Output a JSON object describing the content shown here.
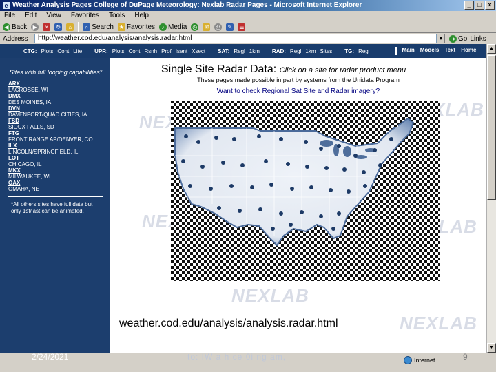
{
  "window": {
    "title": "Weather Analysis Pages College of DuPage Meteorology: Nexlab Radar Pages - Microsoft Internet Explorer",
    "icon": "ie-icon",
    "controls": [
      "_",
      "□",
      "×"
    ]
  },
  "menu": [
    "File",
    "Edit",
    "View",
    "Favorites",
    "Tools",
    "Help"
  ],
  "toolbar": {
    "back": "Back",
    "search": "Search",
    "favorites": "Favorites",
    "media": "Media"
  },
  "address": {
    "label": "Address",
    "value": "http://weather.cod.edu/analysis/analysis.radar.html",
    "go": "Go",
    "links": "Links"
  },
  "nav": {
    "groups": [
      {
        "label": "CTG:",
        "links": [
          "Plots",
          "Cont",
          "Lite"
        ]
      },
      {
        "label": "UPR:",
        "links": [
          "Plots",
          "Cont",
          "Rsnh",
          "Prof",
          "Isent",
          "Xsect"
        ]
      },
      {
        "label": "SAT:",
        "links": [
          "Regl",
          "1km"
        ]
      },
      {
        "label": "RAD:",
        "links": [
          "Regl",
          "1km",
          "Sites"
        ]
      },
      {
        "label": "TG:",
        "links": [
          "Regl"
        ]
      }
    ],
    "main": [
      "Main",
      "Models",
      "Text",
      "Home"
    ]
  },
  "sidebar": {
    "intro": "Sites with full looping capabilities*",
    "sites": [
      {
        "code": "ARX",
        "city": "LACROSSE, WI"
      },
      {
        "code": "DMX",
        "city": "DES MOINES, IA"
      },
      {
        "code": "DVN",
        "city": "DAVENPORT/QUAD CITIES, IA"
      },
      {
        "code": "FSD",
        "city": "SIOUX FALLS, SD"
      },
      {
        "code": "FTG",
        "city": "FRONT RANGE AP/DENVER, CO"
      },
      {
        "code": "ILX",
        "city": "LINCOLN/SPRINGFIELD, IL"
      },
      {
        "code": "LOT",
        "city": "CHICAGO, IL"
      },
      {
        "code": "MKX",
        "city": "MILWAUKEE, WI"
      },
      {
        "code": "OAX",
        "city": "OMAHA, NE"
      }
    ],
    "note": "*All others sites have full data but only 1st/last can be animated."
  },
  "main": {
    "title": "Single Site Radar Data:",
    "title_sub": "Click on a site for radar product menu",
    "subtitle": "These pages made possible in part by systems from the Unidata Program",
    "link": "Want to check Regional Sat Site and Radar imagery?",
    "watermark": "NEXLAB"
  },
  "overlay": {
    "url": "weather.cod.edu/analysis/analysis.radar.html",
    "date": "2/24/2021",
    "footer": "to: IW a h    ce 0i    ng am,",
    "page": "9"
  },
  "status": {
    "zone": "Internet",
    "zone_icon": "globe-icon"
  }
}
